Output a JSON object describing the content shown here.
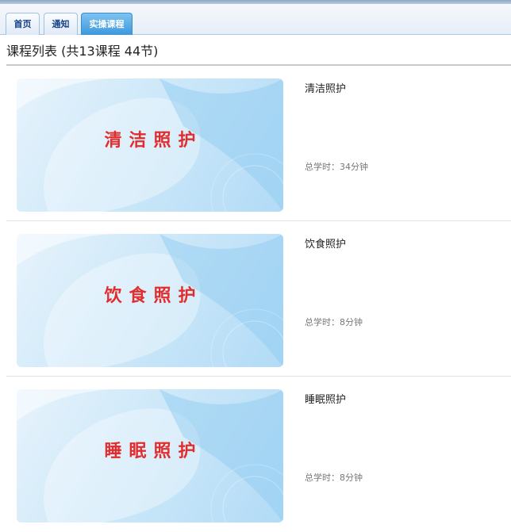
{
  "tabs": [
    {
      "label": "首页",
      "active": false
    },
    {
      "label": "通知",
      "active": false
    },
    {
      "label": "实操课程",
      "active": true
    }
  ],
  "page": {
    "title": "课程列表 (共13课程 44节)"
  },
  "courses": [
    {
      "thumbnail_text": "清洁照护",
      "name": "清洁照护",
      "hours_label": "总学时：",
      "hours_value": "34分钟"
    },
    {
      "thumbnail_text": "饮食照护",
      "name": "饮食照护",
      "hours_label": "总学时：",
      "hours_value": "8分钟"
    },
    {
      "thumbnail_text": "睡眠照护",
      "name": "睡眠照护",
      "hours_label": "总学时：",
      "hours_value": "8分钟"
    }
  ],
  "colors": {
    "active_tab": "#3d98dc",
    "tab_text": "#15428b",
    "thumbnail_title": "#e12d2d",
    "thumbnail_background": "#cde8f9"
  }
}
